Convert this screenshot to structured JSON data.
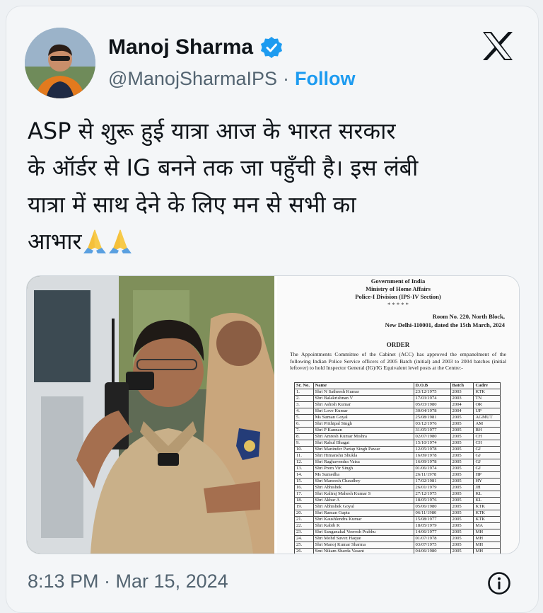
{
  "author": {
    "name": "Manoj Sharma",
    "handle": "@ManojSharmaIPS",
    "separator": "·",
    "follow_label": "Follow"
  },
  "tweet": {
    "lines": [
      "ASP से शुरू हुई यात्रा आज के भारत सरकार",
      "के ऑर्डर से IG बनने तक जा पहुँची है। इस लंबी",
      "यात्रा में साथ देने के लिए मन से सभी का",
      "आभार"
    ],
    "emojis": [
      "folded-hands",
      "folded-hands"
    ]
  },
  "document": {
    "header_lines": [
      "Government of India",
      "Ministry of Home Affairs",
      "Police-I Division (IPS-IV Section)",
      "* * * * *"
    ],
    "address_lines": [
      "Room No. 220, North Block,",
      "New Delhi-110001, dated the 15th March, 2024"
    ],
    "order_title": "ORDER",
    "order_text": "The Appointments Committee of the Cabinet (ACC) has approved the empanelment of the following Indian Police Service officers of 2005 Batch (initial) and 2003 to 2004 batches (initial leftover) to hold Inspector General (IG)/IG Equivalent level posts at the Centre:-",
    "columns": [
      "Sr. No.",
      "Name",
      "D.O.B",
      "Batch",
      "Cadre"
    ],
    "rows": [
      [
        "1.",
        "Shri N Satheesh Kumar",
        "23/12/1975",
        "2003",
        "KTK"
      ],
      [
        "2.",
        "Shri Balakrishnan V",
        "17/03/1974",
        "2003",
        "TN"
      ],
      [
        "3.",
        "Shri Ashish Kumar",
        "05/03/1980",
        "2004",
        "OR"
      ],
      [
        "4.",
        "Shri Love Kumar",
        "30/04/1978",
        "2004",
        "UP"
      ],
      [
        "5.",
        "Ms Suman Goyal",
        "25/08/1981",
        "2005",
        "AGMUT"
      ],
      [
        "6.",
        "Shri Prithipal Singh",
        "03/12/1976",
        "2005",
        "AM"
      ],
      [
        "7.",
        "Shri P Kannan",
        "31/05/1977",
        "2005",
        "BH"
      ],
      [
        "8.",
        "Shri Amresh Kumar Mishra",
        "02/07/1980",
        "2005",
        "CH"
      ],
      [
        "9.",
        "Shri Rahul Bhagat",
        "15/10/1974",
        "2005",
        "CH"
      ],
      [
        "10.",
        "Shri Maninder Partap Singh Pawar",
        "12/05/1978",
        "2005",
        "GJ"
      ],
      [
        "11.",
        "Shri Himanshu Shukla",
        "16/09/1978",
        "2005",
        "GJ"
      ],
      [
        "12.",
        "Shri Raghavendra Vatsa",
        "16/09/1978",
        "2005",
        "GJ"
      ],
      [
        "13.",
        "Shri Prem Vir Singh",
        "01/06/1974",
        "2005",
        "GJ"
      ],
      [
        "14.",
        "Ms Sumedha",
        "26/11/1978",
        "2005",
        "HP"
      ],
      [
        "15.",
        "Shri Maneesh Chaudhry",
        "17/02/1981",
        "2005",
        "HY"
      ],
      [
        "16.",
        "Shri Abhishek",
        "26/01/1979",
        "2005",
        "JH"
      ],
      [
        "17.",
        "Shri Kaliraj Mahesh Kumar S",
        "27/12/1975",
        "2005",
        "KL"
      ],
      [
        "18.",
        "Shri Akbar A",
        "18/05/1976",
        "2005",
        "KL"
      ],
      [
        "19.",
        "Shri Abhishek Goyal",
        "05/06/1980",
        "2005",
        "KTK"
      ],
      [
        "20.",
        "Shri Raman Gupta",
        "06/11/1980",
        "2005",
        "KTK"
      ],
      [
        "21.",
        "Shri Kaushlendra Kumar",
        "15/08/1977",
        "2005",
        "KTK"
      ],
      [
        "22.",
        "Shri Kabib K",
        "18/05/1979",
        "2005",
        "MA"
      ],
      [
        "23.",
        "Shri Sanganakal Veeresh Prabhu",
        "14/06/1977",
        "2005",
        "MH"
      ],
      [
        "24.",
        "Shri Mohd Suvez Haque",
        "01/07/1978",
        "2005",
        "MH"
      ],
      [
        "25.",
        "Shri Manoj Kumar Sharma",
        "03/07/1975",
        "2005",
        "MH"
      ],
      [
        "26.",
        "Smt Nikam Sharda Vasant",
        "04/06/1980",
        "2005",
        "MH"
      ]
    ]
  },
  "timestamp": "8:13 PM · Mar 15, 2024",
  "colors": {
    "follow": "#1d9bf0",
    "verified": "#1d9bf0",
    "text": "#0f1419",
    "muted": "#536471"
  },
  "icons": [
    "verified-badge-icon",
    "x-logo-icon",
    "info-icon",
    "folded-hands-emoji"
  ]
}
